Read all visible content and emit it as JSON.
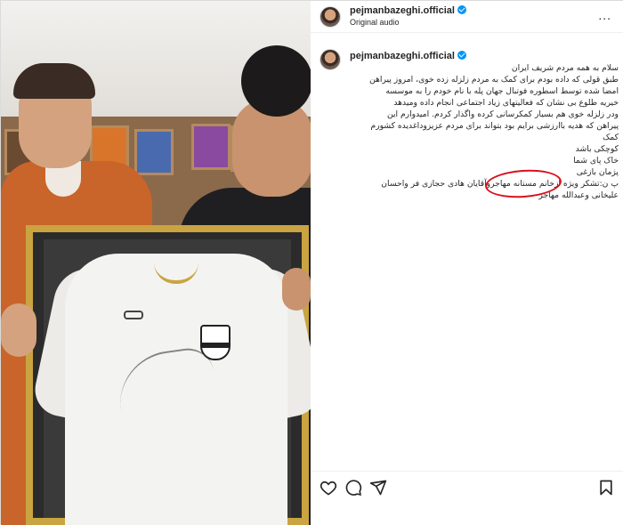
{
  "post": {
    "username": "pejmanbazeghi.official",
    "audio": "Original audio",
    "more_label": "..."
  },
  "caption": {
    "username": "pejmanbazeghi.official",
    "lines": [
      "سلام به همه مردم شریف ایران",
      "طبق قولی که داده بودم برای کمک به مردم زلزله زده خوی، امروز پیراهن",
      "امضا شده توسط اسطوره فوتبال جهان پله با نام خودم را به موسسه",
      "خیریه طلوع بی نشان که فعالیتهای زیاد اجتماعی انجام داده ومیدهد",
      "ودر زلزله خوی هم بسیار کمکرسانی کرده واگذار کردم. امیدوارم این",
      "پیراهن که هدیه باارزشی برایم بود بتواند برای مردم عزیزوداغدیده کشورم",
      "کمک",
      "کوچکی باشد",
      "خاک پای شما",
      "پژمان بازغی"
    ],
    "thanks_prefix": "پ ن:تشکر ویژه از",
    "thanks_marked": "خانم مستانه مهاجر",
    "thanks_suffix": "وآقایان هادی حجازی فر واحسان",
    "last_line": "علیخانی وعبدالله مهاجر"
  },
  "actions": {
    "like_icon": "heart-icon",
    "comment_icon": "comment-icon",
    "share_icon": "send-icon",
    "save_icon": "bookmark-icon"
  },
  "colors": {
    "verified": "#0095f6",
    "highlight_circle": "#d8121d",
    "text": "#262626"
  }
}
